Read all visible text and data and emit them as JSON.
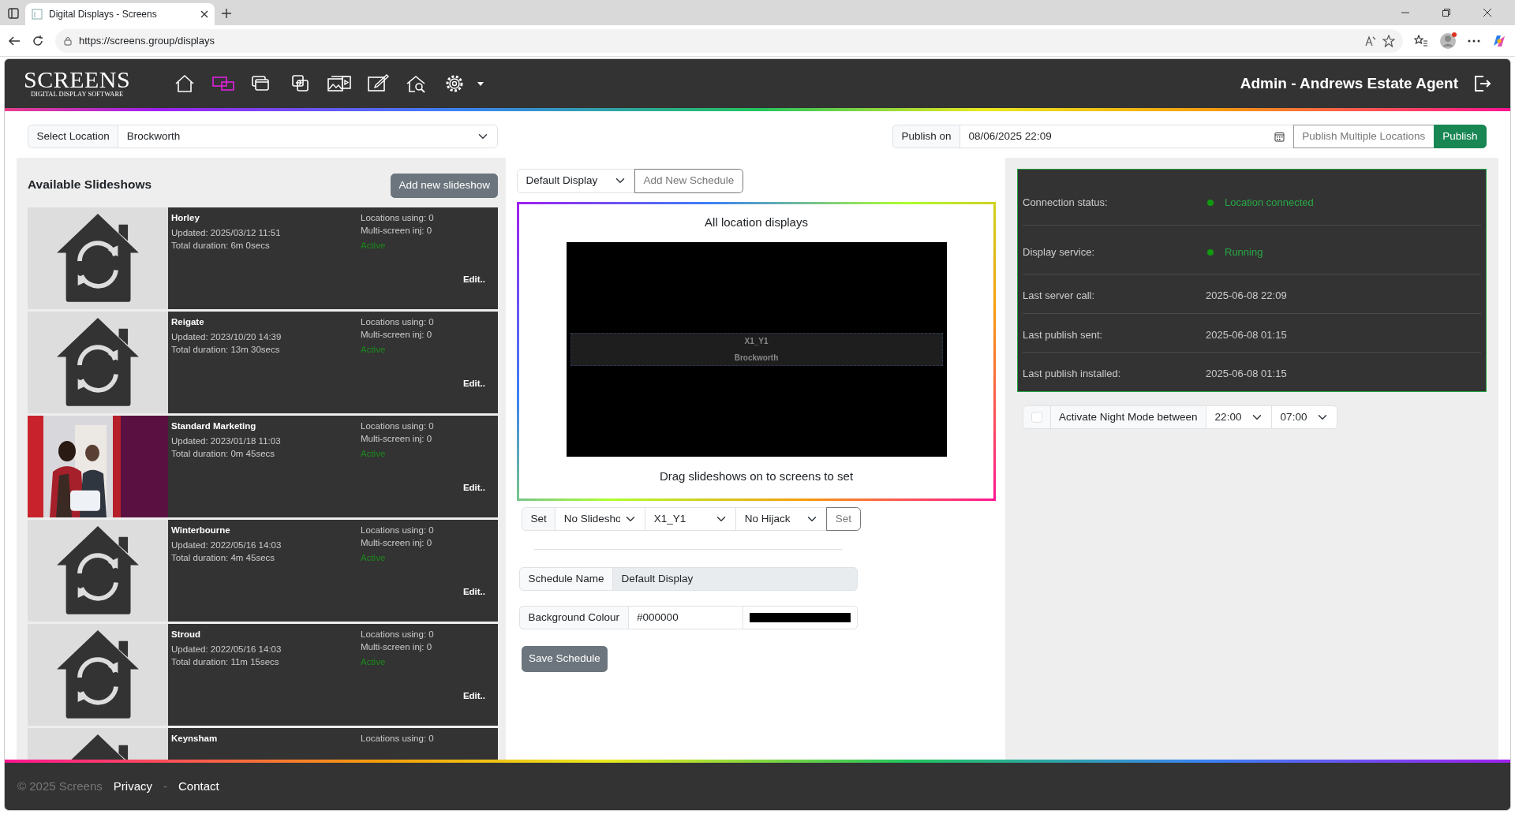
{
  "browser": {
    "tab_title": "Digital Displays - Screens",
    "url": "https://screens.group/displays"
  },
  "header": {
    "logo_title": "SCREENS",
    "logo_subtitle": "DIGITAL DISPLAY SOFTWARE",
    "user": "Admin - Andrews Estate Agent",
    "nav": [
      {
        "kind": "home",
        "selected": false
      },
      {
        "kind": "displays",
        "selected": true
      },
      {
        "kind": "layers",
        "selected": false
      },
      {
        "kind": "swap",
        "selected": false
      },
      {
        "kind": "media",
        "selected": false
      },
      {
        "kind": "edit",
        "selected": false
      },
      {
        "kind": "search-house",
        "selected": false
      },
      {
        "kind": "settings",
        "selected": false
      }
    ]
  },
  "location": {
    "label": "Select Location",
    "value": "Brockworth"
  },
  "publish": {
    "label": "Publish on",
    "date": "08/06/2025 22:09",
    "multi_button": "Publish Multiple Locations",
    "button": "Publish"
  },
  "slideshows": {
    "title": "Available Slideshows",
    "add_button": "Add new slideshow",
    "items": [
      {
        "kind": "icon",
        "name": "Horley",
        "updated": "Updated: 2025/03/12 11:51",
        "duration": "Total duration: 6m 0secs",
        "locations": "Locations using: 0",
        "multi": "Multi-screen inj: 0",
        "status": "Active",
        "edit": "Edit.."
      },
      {
        "kind": "icon",
        "name": "Reigate",
        "updated": "Updated: 2023/10/20 14:39",
        "duration": "Total duration: 13m 30secs",
        "locations": "Locations using: 0",
        "multi": "Multi-screen inj: 0",
        "status": "Active",
        "edit": "Edit.."
      },
      {
        "kind": "picture",
        "name": "Standard Marketing",
        "updated": "Updated: 2023/01/18 11:03",
        "duration": "Total duration: 0m 45secs",
        "locations": "Locations using: 0",
        "multi": "Multi-screen inj: 0",
        "status": "Active",
        "edit": "Edit.."
      },
      {
        "kind": "icon",
        "name": "Winterbourne",
        "updated": "Updated: 2022/05/16 14:03",
        "duration": "Total duration: 4m 45secs",
        "locations": "Locations using: 0",
        "multi": "Multi-screen inj: 0",
        "status": "Active",
        "edit": "Edit.."
      },
      {
        "kind": "icon",
        "name": "Stroud",
        "updated": "Updated: 2022/05/16 14:03",
        "duration": "Total duration: 11m 15secs",
        "locations": "Locations using: 0",
        "multi": "Multi-screen inj: 0",
        "status": "Active",
        "edit": "Edit.."
      },
      {
        "kind": "icon",
        "name": "Keynsham",
        "locations": "Locations using: 0"
      }
    ]
  },
  "schedule": {
    "select": "Default Display",
    "add_button": "Add New Schedule",
    "preview_title": "All location displays",
    "screens": [
      {
        "label": "X1_Y1",
        "location": "Brockworth"
      }
    ],
    "caption": "Drag slideshows on to screens to set",
    "set_row": {
      "label": "Set",
      "slideshow": "No Slidesho",
      "screen": "X1_Y1",
      "hijack": "No Hijack",
      "button": "Set"
    },
    "name_label": "Schedule Name",
    "name": "Default Display",
    "colour_label": "Background Colour",
    "colour": "#000000",
    "save_button": "Save Schedule"
  },
  "status": {
    "rows": [
      {
        "kind": "status",
        "label": "Connection status:",
        "value": "Location connected"
      },
      {
        "kind": "status",
        "label": "Display service:",
        "value": "Running"
      },
      {
        "kind": "plain",
        "label": "Last server call:",
        "value": "2025-06-08 22:09"
      },
      {
        "kind": "plain",
        "label": "Last publish sent:",
        "value": "2025-06-08 01:15"
      },
      {
        "kind": "plain",
        "label": "Last publish installed:",
        "value": "2025-06-08 01:15"
      }
    ]
  },
  "night_mode": {
    "checked": false,
    "label": "Activate Night Mode between",
    "from": "22:00",
    "to": "07:00"
  },
  "footer": {
    "copyright": "© 2025 Screens",
    "links": [
      "Privacy",
      "Contact"
    ],
    "separator": "-"
  }
}
